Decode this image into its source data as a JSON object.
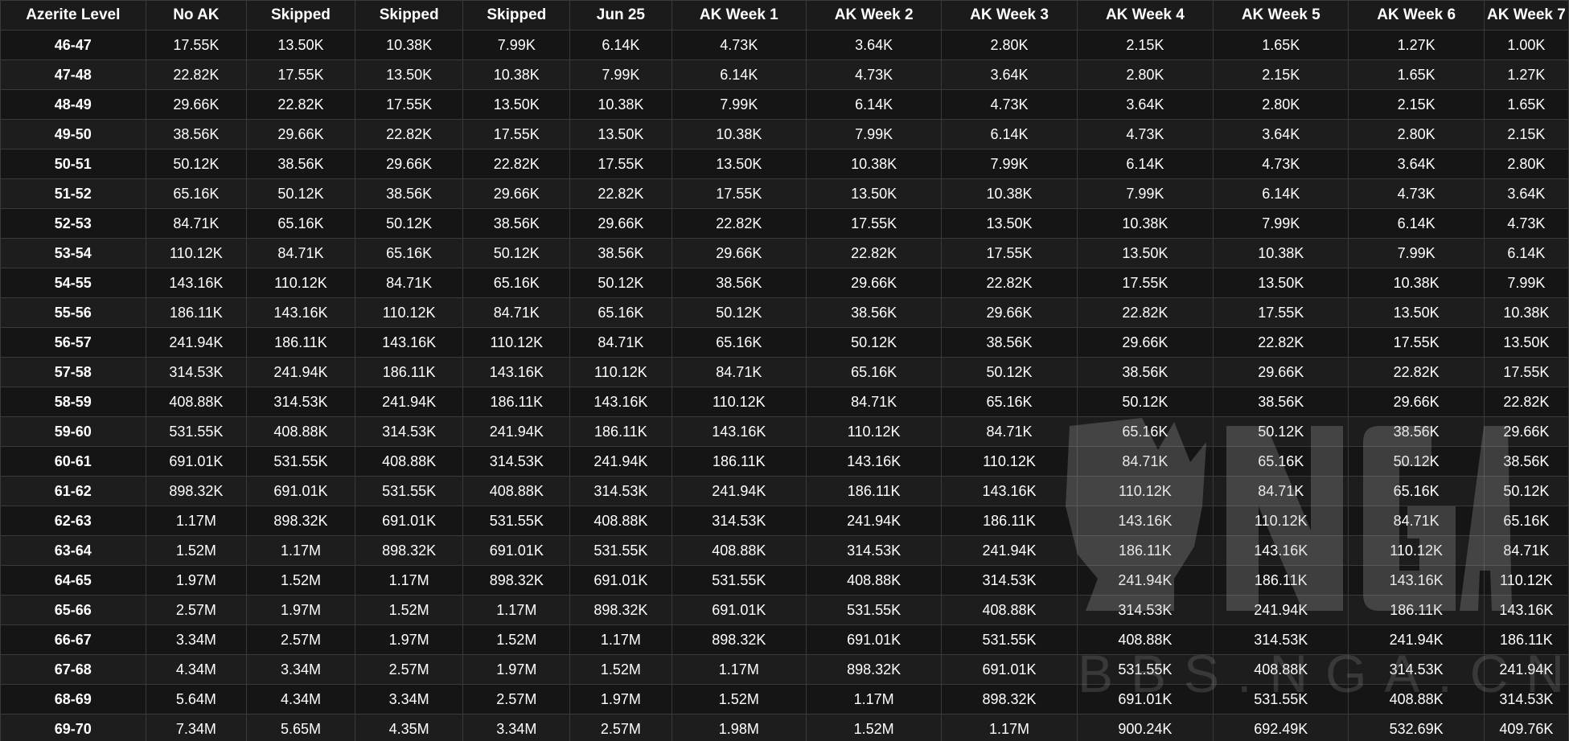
{
  "table": {
    "headers": [
      "Azerite Level",
      "No AK",
      "Skipped",
      "Skipped",
      "Skipped",
      "Jun 25",
      "AK Week 1",
      "AK Week 2",
      "AK Week 3",
      "AK Week 4",
      "AK Week 5",
      "AK Week 6",
      "AK Week 7"
    ],
    "rows": [
      [
        "46-47",
        "17.55K",
        "13.50K",
        "10.38K",
        "7.99K",
        "6.14K",
        "4.73K",
        "3.64K",
        "2.80K",
        "2.15K",
        "1.65K",
        "1.27K",
        "1.00K"
      ],
      [
        "47-48",
        "22.82K",
        "17.55K",
        "13.50K",
        "10.38K",
        "7.99K",
        "6.14K",
        "4.73K",
        "3.64K",
        "2.80K",
        "2.15K",
        "1.65K",
        "1.27K"
      ],
      [
        "48-49",
        "29.66K",
        "22.82K",
        "17.55K",
        "13.50K",
        "10.38K",
        "7.99K",
        "6.14K",
        "4.73K",
        "3.64K",
        "2.80K",
        "2.15K",
        "1.65K"
      ],
      [
        "49-50",
        "38.56K",
        "29.66K",
        "22.82K",
        "17.55K",
        "13.50K",
        "10.38K",
        "7.99K",
        "6.14K",
        "4.73K",
        "3.64K",
        "2.80K",
        "2.15K"
      ],
      [
        "50-51",
        "50.12K",
        "38.56K",
        "29.66K",
        "22.82K",
        "17.55K",
        "13.50K",
        "10.38K",
        "7.99K",
        "6.14K",
        "4.73K",
        "3.64K",
        "2.80K"
      ],
      [
        "51-52",
        "65.16K",
        "50.12K",
        "38.56K",
        "29.66K",
        "22.82K",
        "17.55K",
        "13.50K",
        "10.38K",
        "7.99K",
        "6.14K",
        "4.73K",
        "3.64K"
      ],
      [
        "52-53",
        "84.71K",
        "65.16K",
        "50.12K",
        "38.56K",
        "29.66K",
        "22.82K",
        "17.55K",
        "13.50K",
        "10.38K",
        "7.99K",
        "6.14K",
        "4.73K"
      ],
      [
        "53-54",
        "110.12K",
        "84.71K",
        "65.16K",
        "50.12K",
        "38.56K",
        "29.66K",
        "22.82K",
        "17.55K",
        "13.50K",
        "10.38K",
        "7.99K",
        "6.14K"
      ],
      [
        "54-55",
        "143.16K",
        "110.12K",
        "84.71K",
        "65.16K",
        "50.12K",
        "38.56K",
        "29.66K",
        "22.82K",
        "17.55K",
        "13.50K",
        "10.38K",
        "7.99K"
      ],
      [
        "55-56",
        "186.11K",
        "143.16K",
        "110.12K",
        "84.71K",
        "65.16K",
        "50.12K",
        "38.56K",
        "29.66K",
        "22.82K",
        "17.55K",
        "13.50K",
        "10.38K"
      ],
      [
        "56-57",
        "241.94K",
        "186.11K",
        "143.16K",
        "110.12K",
        "84.71K",
        "65.16K",
        "50.12K",
        "38.56K",
        "29.66K",
        "22.82K",
        "17.55K",
        "13.50K"
      ],
      [
        "57-58",
        "314.53K",
        "241.94K",
        "186.11K",
        "143.16K",
        "110.12K",
        "84.71K",
        "65.16K",
        "50.12K",
        "38.56K",
        "29.66K",
        "22.82K",
        "17.55K"
      ],
      [
        "58-59",
        "408.88K",
        "314.53K",
        "241.94K",
        "186.11K",
        "143.16K",
        "110.12K",
        "84.71K",
        "65.16K",
        "50.12K",
        "38.56K",
        "29.66K",
        "22.82K"
      ],
      [
        "59-60",
        "531.55K",
        "408.88K",
        "314.53K",
        "241.94K",
        "186.11K",
        "143.16K",
        "110.12K",
        "84.71K",
        "65.16K",
        "50.12K",
        "38.56K",
        "29.66K"
      ],
      [
        "60-61",
        "691.01K",
        "531.55K",
        "408.88K",
        "314.53K",
        "241.94K",
        "186.11K",
        "143.16K",
        "110.12K",
        "84.71K",
        "65.16K",
        "50.12K",
        "38.56K"
      ],
      [
        "61-62",
        "898.32K",
        "691.01K",
        "531.55K",
        "408.88K",
        "314.53K",
        "241.94K",
        "186.11K",
        "143.16K",
        "110.12K",
        "84.71K",
        "65.16K",
        "50.12K"
      ],
      [
        "62-63",
        "1.17M",
        "898.32K",
        "691.01K",
        "531.55K",
        "408.88K",
        "314.53K",
        "241.94K",
        "186.11K",
        "143.16K",
        "110.12K",
        "84.71K",
        "65.16K"
      ],
      [
        "63-64",
        "1.52M",
        "1.17M",
        "898.32K",
        "691.01K",
        "531.55K",
        "408.88K",
        "314.53K",
        "241.94K",
        "186.11K",
        "143.16K",
        "110.12K",
        "84.71K"
      ],
      [
        "64-65",
        "1.97M",
        "1.52M",
        "1.17M",
        "898.32K",
        "691.01K",
        "531.55K",
        "408.88K",
        "314.53K",
        "241.94K",
        "186.11K",
        "143.16K",
        "110.12K"
      ],
      [
        "65-66",
        "2.57M",
        "1.97M",
        "1.52M",
        "1.17M",
        "898.32K",
        "691.01K",
        "531.55K",
        "408.88K",
        "314.53K",
        "241.94K",
        "186.11K",
        "143.16K"
      ],
      [
        "66-67",
        "3.34M",
        "2.57M",
        "1.97M",
        "1.52M",
        "1.17M",
        "898.32K",
        "691.01K",
        "531.55K",
        "408.88K",
        "314.53K",
        "241.94K",
        "186.11K"
      ],
      [
        "67-68",
        "4.34M",
        "3.34M",
        "2.57M",
        "1.97M",
        "1.52M",
        "1.17M",
        "898.32K",
        "691.01K",
        "531.55K",
        "408.88K",
        "314.53K",
        "241.94K"
      ],
      [
        "68-69",
        "5.64M",
        "4.34M",
        "3.34M",
        "2.57M",
        "1.97M",
        "1.52M",
        "1.17M",
        "898.32K",
        "691.01K",
        "531.55K",
        "408.88K",
        "314.53K"
      ],
      [
        "69-70",
        "7.34M",
        "5.65M",
        "4.35M",
        "3.34M",
        "2.57M",
        "1.98M",
        "1.52M",
        "1.17M",
        "900.24K",
        "692.49K",
        "532.69K",
        "409.76K"
      ]
    ]
  },
  "watermark": {
    "logo_text": "NGA",
    "url_text": "BBS.NGA.CN",
    "icon": "nga-logo-icon"
  },
  "colors": {
    "background": "#1b1b1b",
    "text": "#ffffff",
    "border": "#3a3a3a"
  }
}
